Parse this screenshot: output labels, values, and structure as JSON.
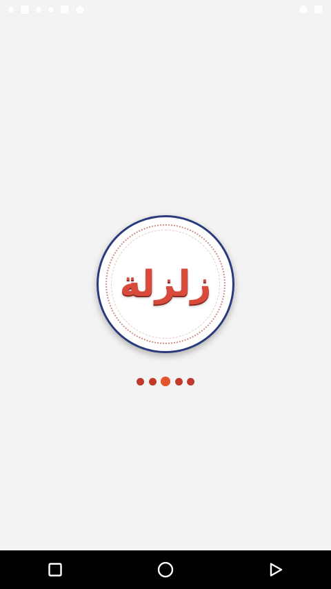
{
  "app": {
    "logo_text": "زلزلة",
    "colors": {
      "logo_red": "#d84a3c",
      "logo_border": "#2a3a7a",
      "dot": "#c03a2a",
      "dot_active": "#e2552d"
    }
  },
  "status_bar": {
    "icons_left": [
      "notification-icon",
      "notification-icon",
      "notification-icon",
      "notification-icon",
      "notification-icon",
      "notification-icon"
    ],
    "icons_right": [
      "signal-icon",
      "battery-icon"
    ]
  },
  "loading": {
    "dot_count": 5,
    "active_index": 2
  },
  "nav_bar": {
    "buttons": [
      "recents-button",
      "home-button",
      "back-button"
    ]
  }
}
